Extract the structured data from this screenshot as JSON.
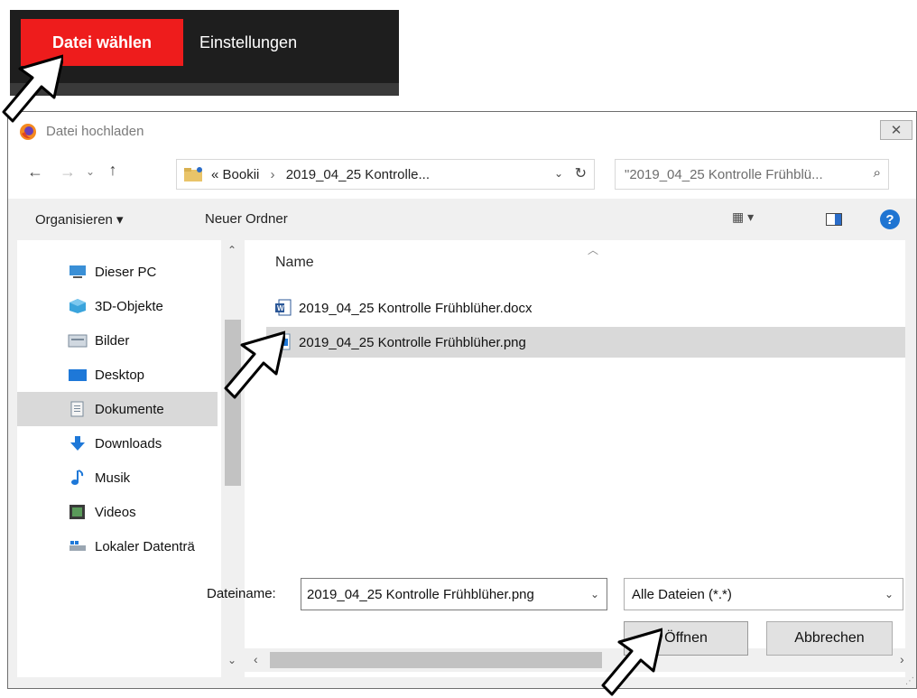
{
  "app_bar": {
    "file_tab_label": "Datei wählen",
    "settings_tab_label": "Einstellungen",
    "accent_color": "#ee1c1c"
  },
  "dialog": {
    "title": "Datei hochladen",
    "close_glyph": "✕",
    "address": {
      "prefix": "«",
      "path_segments": [
        "Bookii",
        "2019_04_25 Kontrolle..."
      ],
      "separator": "›"
    },
    "search_placeholder": "\"2019_04_25 Kontrolle Frühblü...",
    "toolbar": {
      "organize_label": "Organisieren ▾",
      "new_folder_label": "Neuer Ordner",
      "view_glyph": "▦ ▾",
      "help_glyph": "?"
    },
    "nav_pane": {
      "items": [
        {
          "label": "Dieser PC",
          "icon": "pc-icon"
        },
        {
          "label": "3D-Objekte",
          "icon": "cube-icon"
        },
        {
          "label": "Bilder",
          "icon": "pictures-icon"
        },
        {
          "label": "Desktop",
          "icon": "desktop-icon"
        },
        {
          "label": "Dokumente",
          "icon": "documents-icon",
          "selected": true
        },
        {
          "label": "Downloads",
          "icon": "download-icon"
        },
        {
          "label": "Musik",
          "icon": "music-icon"
        },
        {
          "label": "Videos",
          "icon": "video-icon"
        },
        {
          "label": "Lokaler Datenträ",
          "icon": "drive-icon"
        }
      ]
    },
    "file_list": {
      "column_name": "Name",
      "files": [
        {
          "name": "2019_04_25 Kontrolle Frühblüher.docx",
          "icon": "word-doc-icon"
        },
        {
          "name": "2019_04_25 Kontrolle Frühblüher.png",
          "icon": "image-file-icon",
          "selected": true
        }
      ]
    },
    "footer": {
      "filename_label": "Dateiname:",
      "filename_value": "2019_04_25 Kontrolle Frühblüher.png",
      "filter_value": "Alle Dateien (*.*)",
      "open_label": "Öffnen",
      "cancel_label": "Abbrechen"
    }
  }
}
